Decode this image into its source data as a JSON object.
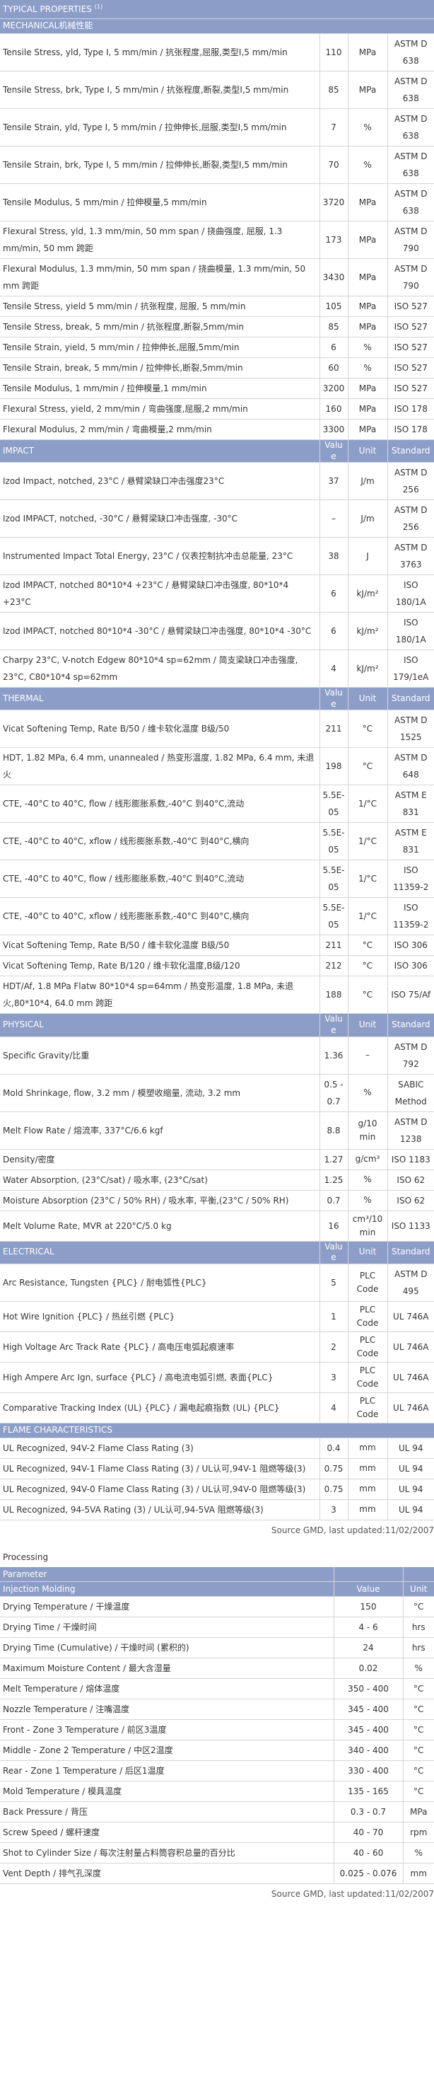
{
  "typical": {
    "header": {
      "title": "TYPICAL PROPERTIES",
      "title_sup": "(1)"
    },
    "sections": [
      {
        "name": "MECHANICAL机械性能",
        "cols": [],
        "rows": [
          {
            "prop": "Tensile Stress, yld, Type I, 5 mm/min / 抗张程度,屈服,类型I,5 mm/min",
            "val": "110",
            "unit": "MPa",
            "std": "ASTM D 638"
          },
          {
            "prop": "Tensile Stress, brk, Type I, 5 mm/min / 抗张程度,断裂,类型I,5 mm/min",
            "val": "85",
            "unit": "MPa",
            "std": "ASTM D 638"
          },
          {
            "prop": "Tensile Strain, yld, Type I, 5 mm/min / 拉伸伸长,屈服,类型I,5 mm/min",
            "val": "7",
            "unit": "%",
            "std": "ASTM D 638"
          },
          {
            "prop": "Tensile Strain, brk, Type I, 5 mm/min / 拉伸伸长,断裂,类型I,5 mm/min",
            "val": "70",
            "unit": "%",
            "std": "ASTM D 638"
          },
          {
            "prop": "Tensile Modulus, 5 mm/min / 拉伸模量,5 mm/min",
            "val": "3720",
            "unit": "MPa",
            "std": "ASTM D 638"
          },
          {
            "prop": "Flexural Stress, yld, 1.3 mm/min, 50 mm span / 挠曲强度, 屈服, 1.3 mm/min, 50 mm 跨距",
            "val": "173",
            "unit": "MPa",
            "std": "ASTM D 790"
          },
          {
            "prop": "Flexural Modulus, 1.3 mm/min, 50 mm span / 挠曲模量, 1.3 mm/min, 50 mm 跨距",
            "val": "3430",
            "unit": "MPa",
            "std": "ASTM D 790"
          },
          {
            "prop": "Tensile Stress, yield 5 mm/min / 抗张程度, 屈服, 5 mm/min",
            "val": "105",
            "unit": "MPa",
            "std": "ISO 527"
          },
          {
            "prop": "Tensile Stress, break, 5 mm/min / 抗张程度,断裂,5mm/min",
            "val": "85",
            "unit": "MPa",
            "std": "ISO 527"
          },
          {
            "prop": "Tensile Strain, yield, 5 mm/min / 拉伸伸长,屈服,5mm/min",
            "val": "6",
            "unit": "%",
            "std": "ISO 527"
          },
          {
            "prop": "Tensile Strain, break, 5 mm/min / 拉伸伸长,断裂,5mm/min",
            "val": "60",
            "unit": "%",
            "std": "ISO 527"
          },
          {
            "prop": "Tensile Modulus, 1 mm/min / 拉伸模量,1 mm/min",
            "val": "3200",
            "unit": "MPa",
            "std": "ISO 527"
          },
          {
            "prop": "Flexural Stress, yield, 2 mm/min / 弯曲强度,屈服,2 mm/min",
            "val": "160",
            "unit": "MPa",
            "std": "ISO 178"
          },
          {
            "prop": "Flexural Modulus, 2 mm/min / 弯曲模量,2 mm/min",
            "val": "3300",
            "unit": "MPa",
            "std": "ISO 178"
          }
        ]
      },
      {
        "name": "IMPACT",
        "cols": [
          "Value",
          "Unit",
          "Standard"
        ],
        "rows": [
          {
            "prop": "Izod Impact, notched, 23°C / 悬臂梁缺口冲击强度23°C",
            "val": "37",
            "unit": "J/m",
            "std": "ASTM D 256"
          },
          {
            "prop": "Izod IMPACT, notched, -30°C / 悬臂梁缺口冲击强度, -30°C",
            "val": "–",
            "unit": "J/m",
            "std": "ASTM D 256"
          },
          {
            "prop": "Instrumented Impact Total Energy, 23°C / 仪表控制抗冲击总能量, 23°C",
            "val": "38",
            "unit": "J",
            "std": "ASTM D 3763"
          },
          {
            "prop": "Izod IMPACT, notched 80*10*4 +23°C / 悬臂梁缺口冲击强度, 80*10*4 +23°C",
            "val": "6",
            "unit": "kJ/m²",
            "std": "ISO 180/1A"
          },
          {
            "prop": "Izod IMPACT, notched 80*10*4 -30°C / 悬臂梁缺口冲击强度, 80*10*4 -30°C",
            "val": "6",
            "unit": "kJ/m²",
            "std": "ISO 180/1A"
          },
          {
            "prop": "Charpy 23°C, V-notch Edgew 80*10*4 sp=62mm / 简支梁缺口冲击强度, 23°C, C80*10*4 sp=62mm",
            "val": "4",
            "unit": "kJ/m²",
            "std": "ISO 179/1eA"
          }
        ]
      },
      {
        "name": "THERMAL",
        "cols": [
          "Value",
          "Unit",
          "Standard"
        ],
        "rows": [
          {
            "prop": "Vicat Softening Temp, Rate B/50 / 维卡软化温度 B级/50",
            "val": "211",
            "unit": "°C",
            "std": "ASTM D 1525"
          },
          {
            "prop": "HDT, 1.82 MPa, 6.4 mm, unannealed / 热变形温度, 1.82 MPa, 6.4 mm, 未退火",
            "val": "198",
            "unit": "°C",
            "std": "ASTM D 648"
          },
          {
            "prop": "CTE, -40°C to 40°C, flow / 线形膨胀系数,-40°C 到40°C,流动",
            "val": "5.5E-05",
            "unit": "1/°C",
            "std": "ASTM E 831"
          },
          {
            "prop": "CTE, -40°C to 40°C, xflow / 线形膨胀系数,-40°C 到40°C,横向",
            "val": "5.5E-05",
            "unit": "1/°C",
            "std": "ASTM E 831"
          },
          {
            "prop": "CTE, -40°C to 40°C, flow / 线形膨胀系数,-40°C 到40°C,流动",
            "val": "5.5E-05",
            "unit": "1/°C",
            "std": "ISO 11359-2"
          },
          {
            "prop": "CTE, -40°C to 40°C, xflow / 线形膨胀系数,-40°C 到40°C,横向",
            "val": "5.5E-05",
            "unit": "1/°C",
            "std": "ISO 11359-2"
          },
          {
            "prop": "Vicat Softening Temp, Rate B/50 / 维卡软化温度 B级/50",
            "val": "211",
            "unit": "°C",
            "std": "ISO 306"
          },
          {
            "prop": "Vicat Softening Temp, Rate B/120 / 维卡软化温度,B级/120",
            "val": "212",
            "unit": "°C",
            "std": "ISO 306"
          },
          {
            "prop": "HDT/Af, 1.8 MPa Flatw 80*10*4 sp=64mm / 热变形温度, 1.8 MPa, 未退火,80*10*4, 64.0 mm 跨距",
            "val": "188",
            "unit": "°C",
            "std": "ISO 75/Af"
          }
        ]
      },
      {
        "name": "PHYSICAL",
        "cols": [
          "Value",
          "Unit",
          "Standard"
        ],
        "rows": [
          {
            "prop": "Specific Gravity/比重",
            "val": "1.36",
            "unit": "–",
            "std": "ASTM D 792"
          },
          {
            "prop": "Mold Shrinkage, flow, 3.2 mm / 模塑收缩量, 流动, 3.2 mm",
            "val": "0.5 - 0.7",
            "unit": "%",
            "std": "SABIC Method"
          },
          {
            "prop": "Melt Flow Rate / 熔流率, 337°C/6.6 kgf",
            "val": "8.8",
            "unit": "g/10 min",
            "std": "ASTM D 1238"
          },
          {
            "prop": "Density/密度",
            "val": "1.27",
            "unit": "g/cm³",
            "std": "ISO 1183"
          },
          {
            "prop": "Water Absorption, (23°C/sat) / 吸水率, (23°C/sat)",
            "val": "1.25",
            "unit": "%",
            "std": "ISO 62"
          },
          {
            "prop": "Moisture Absorption (23°C / 50% RH) / 吸水率, 平衡,(23°C / 50% RH)",
            "val": "0.7",
            "unit": "%",
            "std": "ISO 62"
          },
          {
            "prop": "Melt Volume Rate, MVR at 220°C/5.0 kg",
            "val": "16",
            "unit": "cm³/10 min",
            "std": "ISO 1133"
          }
        ]
      },
      {
        "name": "ELECTRICAL",
        "cols": [
          "Value",
          "Unit",
          "Standard"
        ],
        "rows": [
          {
            "prop": "Arc Resistance, Tungsten {PLC} / 耐电弧性{PLC}",
            "val": "5",
            "unit": "PLC Code",
            "std": "ASTM D 495"
          },
          {
            "prop": "Hot Wire Ignition {PLC} / 热丝引燃 {PLC}",
            "val": "1",
            "unit": "PLC Code",
            "std": "UL 746A"
          },
          {
            "prop": "High Voltage Arc Track Rate {PLC} / 高电压电弧起痕速率",
            "val": "2",
            "unit": "PLC Code",
            "std": "UL 746A"
          },
          {
            "prop": "High Ampere Arc Ign, surface {PLC} / 高电流电弧引燃, 表面{PLC}",
            "val": "3",
            "unit": "PLC Code",
            "std": "UL 746A"
          },
          {
            "prop": "Comparative Tracking Index (UL) {PLC} / 漏电起痕指数 (UL) {PLC}",
            "val": "4",
            "unit": "PLC Code",
            "std": "UL 746A"
          }
        ]
      },
      {
        "name": "FLAME CHARACTERISTICS",
        "cols": [],
        "rows": [
          {
            "prop": "UL Recognized, 94V-2 Flame Class Rating (3)",
            "val": "0.4",
            "unit": "mm",
            "std": "UL 94"
          },
          {
            "prop": "UL Recognized, 94V-1 Flame Class Rating (3) / UL认可,94V-1 阻燃等级(3)",
            "val": "0.75",
            "unit": "mm",
            "std": "UL 94"
          },
          {
            "prop": "UL Recognized, 94V-0 Flame Class Rating (3) / UL认可,94V-0 阻燃等级(3)",
            "val": "0.75",
            "unit": "mm",
            "std": "UL 94"
          },
          {
            "prop": "UL Recognized, 94-5VA Rating (3) / UL认可,94-5VA 阻燃等级(3)",
            "val": "3",
            "unit": "mm",
            "std": "UL 94"
          }
        ]
      }
    ],
    "source": "Source GMD, last updated:11/02/2007"
  },
  "processing": {
    "title": "Processing",
    "header": {
      "prop": "Parameter",
      "val": "",
      "unit": ""
    },
    "subheader": {
      "prop": "Injection Molding",
      "val": "Value",
      "unit": "Unit"
    },
    "rows": [
      {
        "prop": "Drying Temperature / 干燥温度",
        "val": "150",
        "unit": "°C"
      },
      {
        "prop": "Drying Time / 干燥时间",
        "val": "4 - 6",
        "unit": "hrs"
      },
      {
        "prop": "Drying Time (Cumulative) / 干燥时间 (累积的)",
        "val": "24",
        "unit": "hrs"
      },
      {
        "prop": "Maximum Moisture Content / 最大含湿量",
        "val": "0.02",
        "unit": "%"
      },
      {
        "prop": "Melt Temperature / 熔体温度",
        "val": "350 - 400",
        "unit": "°C"
      },
      {
        "prop": "Nozzle Temperature / 注嘴温度",
        "val": "345 - 400",
        "unit": "°C"
      },
      {
        "prop": "Front - Zone 3 Temperature / 前区3温度",
        "val": "345 - 400",
        "unit": "°C"
      },
      {
        "prop": "Middle - Zone 2 Temperature / 中区2温度",
        "val": "340 - 400",
        "unit": "°C"
      },
      {
        "prop": "Rear - Zone 1 Temperature / 后区1温度",
        "val": "330 - 400",
        "unit": "°C"
      },
      {
        "prop": "Mold Temperature / 模具温度",
        "val": "135 - 165",
        "unit": "°C"
      },
      {
        "prop": "Back Pressure / 背压",
        "val": "0.3 - 0.7",
        "unit": "MPa"
      },
      {
        "prop": "Screw Speed / 螺杆速度",
        "val": "40 - 70",
        "unit": "rpm"
      },
      {
        "prop": "Shot to Cylinder Size / 每次注射量占料筒容积总量的百分比",
        "val": "40 - 60",
        "unit": "%"
      },
      {
        "prop": "Vent Depth / 排气孔深度",
        "val": "0.025 - 0.076",
        "unit": "mm"
      }
    ],
    "source": "Source GMD, last updated:11/02/2007"
  }
}
